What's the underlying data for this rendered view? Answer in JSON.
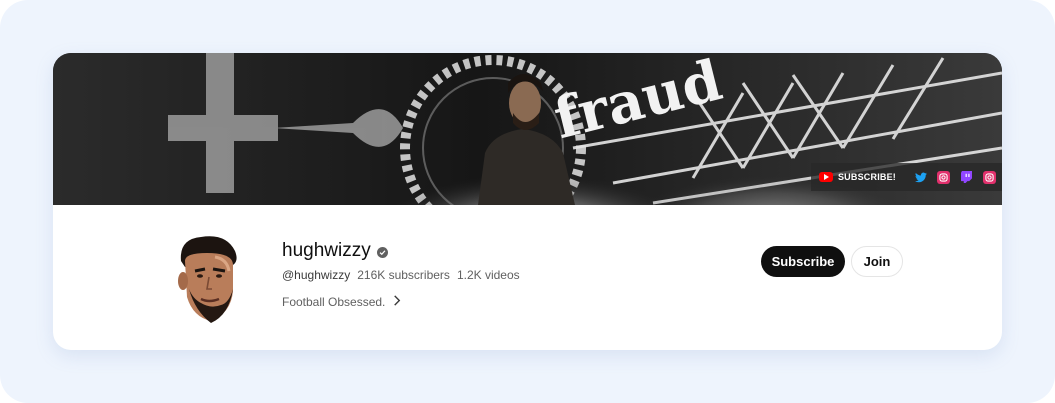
{
  "banner": {
    "title_art": "fraud",
    "links": {
      "subscribe_label": "SUBSCRIBE!",
      "icons": [
        "youtube-icon",
        "twitter-icon",
        "instagram-icon",
        "twitch-icon",
        "instagram-icon"
      ]
    }
  },
  "channel": {
    "name": "hughwizzy",
    "handle": "@hughwizzy",
    "subscribers": "216K subscribers",
    "videos": "1.2K videos",
    "description": "Football Obsessed.",
    "verified": true
  },
  "actions": {
    "subscribe_label": "Subscribe",
    "join_label": "Join"
  },
  "colors": {
    "page_bg": "#eef4fd",
    "card_bg": "#ffffff",
    "subscribe_bg": "#0f0f0f",
    "youtube_red": "#ff0000",
    "twitter_blue": "#1da1f2",
    "instagram_pink": "#e1306c",
    "twitch_purple": "#9146ff"
  }
}
